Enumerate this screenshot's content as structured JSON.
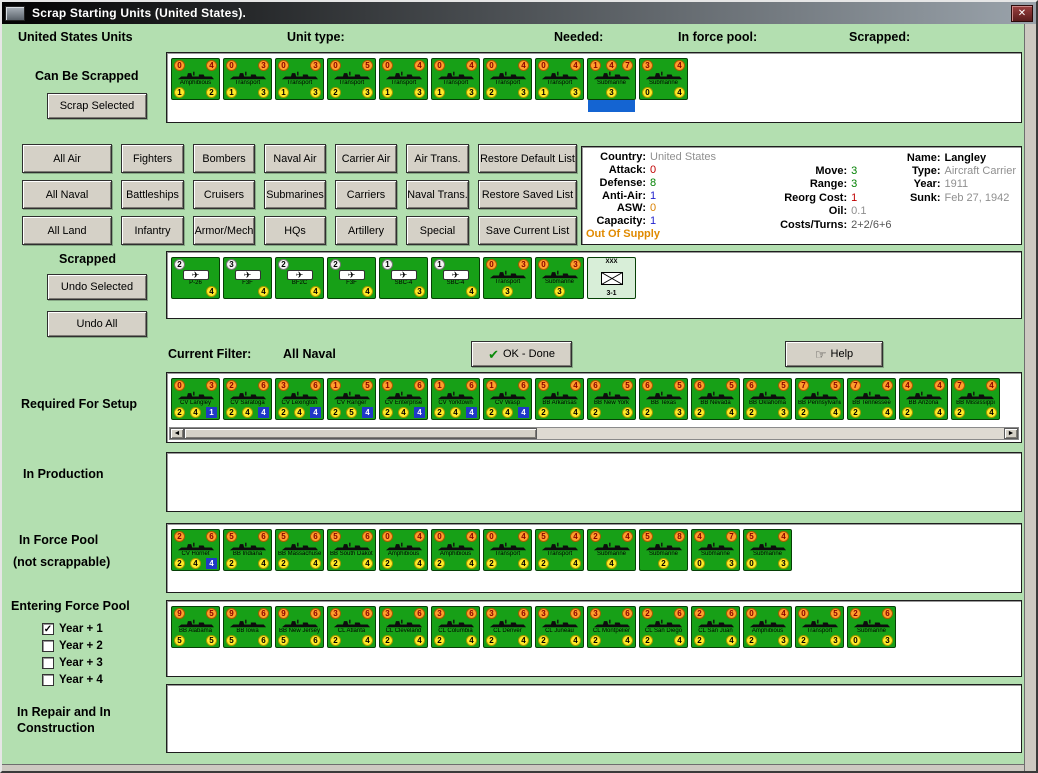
{
  "window": {
    "title": "Scrap Starting Units (United States)."
  },
  "icons": {
    "close": "✕",
    "ok_check": "✔",
    "help_hand": "☞",
    "scroll_left": "◄",
    "scroll_right": "►",
    "checkbox_check": "✓",
    "plane": "✈"
  },
  "header": {
    "title": "United States Units",
    "unit_type": "Unit type:",
    "needed": "Needed:",
    "in_force_pool": "In force pool:",
    "scrapped": "Scrapped:"
  },
  "filters": {
    "buttons": [
      "All Air",
      "Fighters",
      "Bombers",
      "Naval Air",
      "Carrier Air",
      "Air Trans.",
      "Restore Default List",
      "All Naval",
      "Battleships",
      "Cruisers",
      "Submarines",
      "Carriers",
      "Naval Trans.",
      "Restore Saved List",
      "All Land",
      "Infantry",
      "Armor/Mech",
      "HQs",
      "Artillery",
      "Special",
      "Save Current List"
    ]
  },
  "info": {
    "col1": [
      {
        "label": "Country:",
        "value": "United States",
        "color": "#8f8f8f"
      },
      {
        "label": "Attack:",
        "value": "0",
        "color": "#c00000"
      },
      {
        "label": "Defense:",
        "value": "8",
        "color": "#008000"
      },
      {
        "label": "Anti-Air:",
        "value": "1",
        "color": "#2222cc"
      },
      {
        "label": "ASW:",
        "value": "0",
        "color": "#d98000"
      },
      {
        "label": "Capacity:",
        "value": "1",
        "color": "#2222cc"
      },
      {
        "label": "",
        "value": "Out Of Supply",
        "color": "#e08a00",
        "bold": true
      }
    ],
    "col2": [
      {
        "label": "",
        "value": ""
      },
      {
        "label": "Move:",
        "value": "3",
        "color": "#008000"
      },
      {
        "label": "Range:",
        "value": "3",
        "color": "#008000"
      },
      {
        "label": "Reorg Cost:",
        "value": "1",
        "color": "#c00000"
      },
      {
        "label": "Oil:",
        "value": "0.1",
        "color": "#8f8f8f"
      },
      {
        "label": "Costs/Turns:",
        "value": "2+2/6+6",
        "color": "#555555"
      }
    ],
    "col3": [
      {
        "label": "Name:",
        "value": "Langley",
        "color": "#000000",
        "bold": true
      },
      {
        "label": "Type:",
        "value": "Aircraft Carrier",
        "color": "#8f8f8f"
      },
      {
        "label": "Year:",
        "value": "1911",
        "color": "#8f8f8f"
      },
      {
        "label": "Sunk:",
        "value": "Feb 27, 1942",
        "color": "#8f8f8f"
      }
    ]
  },
  "sections": {
    "can_be_scrapped": {
      "label": "Can Be Scrapped",
      "scrap_button": "Scrap Selected",
      "units": [
        {
          "name": "Amphibious",
          "top": [
            "0",
            "4"
          ],
          "bot": [
            "1",
            "2"
          ]
        },
        {
          "name": "Transport",
          "top": [
            "0",
            "3"
          ],
          "bot": [
            "1",
            "3"
          ]
        },
        {
          "name": "Transport",
          "top": [
            "0",
            "3"
          ],
          "bot": [
            "1",
            "3"
          ]
        },
        {
          "name": "Transport",
          "top": [
            "0",
            "5"
          ],
          "bot": [
            "2",
            "3"
          ]
        },
        {
          "name": "Transport",
          "top": [
            "0",
            "4"
          ],
          "bot": [
            "1",
            "3"
          ]
        },
        {
          "name": "Transport",
          "top": [
            "0",
            "4"
          ],
          "bot": [
            "1",
            "3"
          ]
        },
        {
          "name": "Transport",
          "top": [
            "0",
            "4"
          ],
          "bot": [
            "2",
            "3"
          ]
        },
        {
          "name": "Transport",
          "top": [
            "0",
            "4"
          ],
          "bot": [
            "1",
            "3"
          ]
        },
        {
          "name": "Submarine",
          "top": [
            "1",
            "4",
            "7"
          ],
          "bot": [
            "3"
          ],
          "selected": true
        },
        {
          "name": "Submarine",
          "top": [
            "3",
            "4"
          ],
          "bot": [
            "0",
            "4"
          ]
        }
      ]
    },
    "scrapped": {
      "label": "Scrapped",
      "undo_selected_button": "Undo Selected",
      "undo_all_button": "Undo All",
      "units": [
        {
          "kind": "air",
          "name": "P-26",
          "num": "2",
          "bot": "4"
        },
        {
          "kind": "air",
          "name": "F3F",
          "num": "3",
          "bot": "4"
        },
        {
          "kind": "air",
          "name": "BF2C",
          "num": "2",
          "bot": "4"
        },
        {
          "kind": "air",
          "name": "F3F",
          "num": "2",
          "bot": "4"
        },
        {
          "kind": "air",
          "name": "SBC-4",
          "num": "1",
          "bot": "3"
        },
        {
          "kind": "air",
          "name": "SBC-4",
          "num": "1",
          "bot": "4"
        },
        {
          "name": "Transport",
          "top": [
            "0",
            "3"
          ],
          "bot": [
            "3"
          ]
        },
        {
          "name": "Submarine",
          "top": [
            "0",
            "3"
          ],
          "bot": [
            "3"
          ]
        },
        {
          "kind": "land",
          "size": "XXX",
          "name": "3-1"
        }
      ]
    },
    "filter_bar": {
      "label": "Current Filter:",
      "value": "All Naval",
      "ok_button": "OK - Done",
      "help_button": "Help"
    },
    "required_for_setup": {
      "label": "Required For Setup",
      "units": [
        {
          "name": "CV Langley",
          "top": [
            "0",
            "3"
          ],
          "bot": [
            "2",
            "4"
          ],
          "cap": "1"
        },
        {
          "name": "CV Saratoga",
          "top": [
            "2",
            "6"
          ],
          "bot": [
            "2",
            "4"
          ],
          "cap": "4"
        },
        {
          "name": "CV Lexington",
          "top": [
            "3",
            "6"
          ],
          "bot": [
            "2",
            "4"
          ],
          "cap": "4"
        },
        {
          "name": "CV Ranger",
          "top": [
            "1",
            "5"
          ],
          "bot": [
            "2",
            "5"
          ],
          "cap": "4"
        },
        {
          "name": "CV Enterprise",
          "top": [
            "1",
            "6"
          ],
          "bot": [
            "2",
            "4"
          ],
          "cap": "4"
        },
        {
          "name": "CV Yorktown",
          "top": [
            "1",
            "6"
          ],
          "bot": [
            "2",
            "4"
          ],
          "cap": "4"
        },
        {
          "name": "CV Wasp",
          "top": [
            "1",
            "6"
          ],
          "bot": [
            "2",
            "4"
          ],
          "cap": "4"
        },
        {
          "name": "BB Arkansas",
          "top": [
            "5",
            "4"
          ],
          "bot": [
            "2",
            "4"
          ]
        },
        {
          "name": "BB New York",
          "top": [
            "6",
            "5"
          ],
          "bot": [
            "2",
            "3"
          ]
        },
        {
          "name": "BB Texas",
          "top": [
            "6",
            "5"
          ],
          "bot": [
            "2",
            "3"
          ]
        },
        {
          "name": "BB Nevada",
          "top": [
            "6",
            "5"
          ],
          "bot": [
            "2",
            "4"
          ]
        },
        {
          "name": "BB Oklahoma",
          "top": [
            "6",
            "5"
          ],
          "bot": [
            "2",
            "3"
          ]
        },
        {
          "name": "BB Pennsylvania",
          "top": [
            "7",
            "5"
          ],
          "bot": [
            "2",
            "4"
          ]
        },
        {
          "name": "BB Tennessee",
          "top": [
            "7",
            "4"
          ],
          "bot": [
            "2",
            "4"
          ]
        },
        {
          "name": "BB Arizona",
          "top": [
            "4",
            "4"
          ],
          "bot": [
            "2",
            "4"
          ]
        },
        {
          "name": "BB Mississippi",
          "top": [
            "7",
            "4"
          ],
          "bot": [
            "2",
            "4"
          ]
        }
      ]
    },
    "in_production": {
      "label": "In Production",
      "units": []
    },
    "in_force_pool": {
      "label": "In Force Pool",
      "sublabel": "(not scrappable)",
      "units": [
        {
          "name": "CV Hornet",
          "top": [
            "2",
            "6"
          ],
          "bot": [
            "2",
            "4"
          ],
          "cap": "4"
        },
        {
          "name": "BB Indiana",
          "top": [
            "5",
            "6"
          ],
          "bot": [
            "2",
            "4"
          ]
        },
        {
          "name": "BB Massachusetts",
          "top": [
            "5",
            "6"
          ],
          "bot": [
            "2",
            "4"
          ]
        },
        {
          "name": "BB South Dakota",
          "top": [
            "5",
            "6"
          ],
          "bot": [
            "2",
            "4"
          ]
        },
        {
          "name": "Amphibious",
          "top": [
            "0",
            "4"
          ],
          "bot": [
            "2",
            "4"
          ]
        },
        {
          "name": "Amphibious",
          "top": [
            "0",
            "4"
          ],
          "bot": [
            "2",
            "4"
          ]
        },
        {
          "name": "Transport",
          "top": [
            "0",
            "4"
          ],
          "bot": [
            "2",
            "4"
          ]
        },
        {
          "name": "Transport",
          "top": [
            "5",
            "4"
          ],
          "bot": [
            "2",
            "4"
          ]
        },
        {
          "name": "Submarine",
          "top": [
            "2",
            "4"
          ],
          "bot": [
            "4"
          ]
        },
        {
          "name": "Submarine",
          "top": [
            "5",
            "8"
          ],
          "bot": [
            "2"
          ]
        },
        {
          "name": "Submarine",
          "top": [
            "4",
            "7"
          ],
          "bot": [
            "0",
            "3"
          ]
        },
        {
          "name": "Submarine",
          "top": [
            "5",
            "4"
          ],
          "bot": [
            "0",
            "3"
          ]
        }
      ]
    },
    "entering_force_pool": {
      "label": "Entering Force Pool",
      "checkboxes": [
        {
          "label": "Year + 1",
          "checked": true
        },
        {
          "label": "Year + 2",
          "checked": false
        },
        {
          "label": "Year + 3",
          "checked": false
        },
        {
          "label": "Year + 4",
          "checked": false
        }
      ],
      "units": [
        {
          "name": "BB Alabama",
          "top": [
            "9",
            "5"
          ],
          "bot": [
            "5",
            "5"
          ]
        },
        {
          "name": "BB Iowa",
          "top": [
            "9",
            "6"
          ],
          "bot": [
            "5",
            "6"
          ]
        },
        {
          "name": "BB New Jersey",
          "top": [
            "9",
            "6"
          ],
          "bot": [
            "5",
            "6"
          ]
        },
        {
          "name": "CL Atlanta",
          "top": [
            "3",
            "6"
          ],
          "bot": [
            "2",
            "4"
          ]
        },
        {
          "name": "CL Cleveland",
          "top": [
            "3",
            "6"
          ],
          "bot": [
            "2",
            "4"
          ]
        },
        {
          "name": "CL Columbia",
          "top": [
            "3",
            "6"
          ],
          "bot": [
            "2",
            "4"
          ]
        },
        {
          "name": "CL Denver",
          "top": [
            "3",
            "6"
          ],
          "bot": [
            "2",
            "4"
          ]
        },
        {
          "name": "CL Juneau",
          "top": [
            "3",
            "6"
          ],
          "bot": [
            "2",
            "4"
          ]
        },
        {
          "name": "CL Montpelier",
          "top": [
            "3",
            "6"
          ],
          "bot": [
            "2",
            "4"
          ]
        },
        {
          "name": "CL San Diego",
          "top": [
            "2",
            "6"
          ],
          "bot": [
            "2",
            "4"
          ]
        },
        {
          "name": "CL San Juan",
          "top": [
            "2",
            "6"
          ],
          "bot": [
            "2",
            "4"
          ]
        },
        {
          "name": "Amphibious",
          "top": [
            "0",
            "4"
          ],
          "bot": [
            "2",
            "3"
          ]
        },
        {
          "name": "Transport",
          "top": [
            "0",
            "5"
          ],
          "bot": [
            "2",
            "3"
          ]
        },
        {
          "name": "Submarine",
          "top": [
            "2",
            "6"
          ],
          "bot": [
            "0",
            "3"
          ]
        }
      ]
    },
    "in_repair": {
      "label": "In Repair and In Construction",
      "units": []
    }
  }
}
